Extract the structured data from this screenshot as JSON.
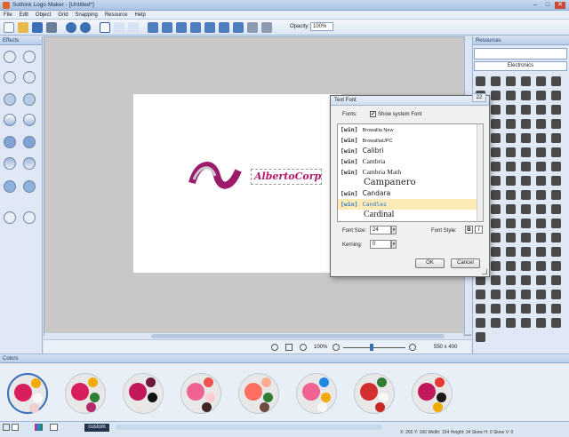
{
  "window": {
    "title": "Sothink Logo Maker - [Untitled*]",
    "minimize": "–",
    "maximize": "□",
    "close": "✕"
  },
  "menu": [
    "File",
    "Edit",
    "Object",
    "Grid",
    "Snapping",
    "Resource",
    "Help"
  ],
  "toolbar": {
    "opacity_label": "Opacity:",
    "opacity_value": "100%"
  },
  "panels": {
    "effects": "Effects",
    "resources": "Resources",
    "colors": "Colors"
  },
  "resources": {
    "category": "Electronics"
  },
  "logo": {
    "text": "AlbertoCorp",
    "text_color": "#b3186e"
  },
  "zoombar": {
    "zoom": "100%",
    "size": "550 x 400"
  },
  "dialog": {
    "title": "Text Font",
    "fonts_label": "Fonts:",
    "show_system_font": "Show system Font",
    "show_system_checked": "✔",
    "font_list": [
      {
        "tag": "[win]",
        "name": "Browallia New"
      },
      {
        "tag": "[win]",
        "name": "BrowalliaUPC"
      },
      {
        "tag": "[win]",
        "name": "Calibri"
      },
      {
        "tag": "[win]",
        "name": "Cambria"
      },
      {
        "tag": "[win]",
        "name": "Cambria Math"
      },
      {
        "tag": "",
        "name": "Campanero"
      },
      {
        "tag": "[win]",
        "name": "Candara"
      },
      {
        "tag": "[win]",
        "name": "Candles"
      },
      {
        "tag": "",
        "name": "Cardinal"
      }
    ],
    "selected_index": 7,
    "font_size_label": "Font Size:",
    "font_size": "24",
    "font_style_label": "Font Style:",
    "bold": "B",
    "italic": "I",
    "kerning_label": "Kerning:",
    "kerning": "0",
    "ok": "OK",
    "cancel": "Cancel"
  },
  "color_schemes": [
    [
      "#d81e5b",
      "#f2a900",
      "#f7f7f7",
      "#f0cfd2"
    ],
    [
      "#d81e5b",
      "#f2a900",
      "#2e7d32",
      "#b22a6b"
    ],
    [
      "#c2185b",
      "#6d1b3b",
      "#111111",
      "#e8e8e8"
    ],
    [
      "#f06292",
      "#ef5350",
      "#ffcdd2",
      "#3e2723"
    ],
    [
      "#ff6f61",
      "#ffab91",
      "#2e7d32",
      "#6d4c41"
    ],
    [
      "#f06292",
      "#1e88e5",
      "#f2a900",
      "#f7f7f7"
    ],
    [
      "#d32f2f",
      "#2e7d32",
      "#f7f7f7",
      "#c62828"
    ],
    [
      "#c2185b",
      "#e53935",
      "#1a1a1a",
      "#f2a900"
    ]
  ],
  "status": {
    "custom": "custom",
    "info": "X: 265  Y: 166  Width: 154  Height: 34  Skew H: 0  Skew V: 0"
  }
}
